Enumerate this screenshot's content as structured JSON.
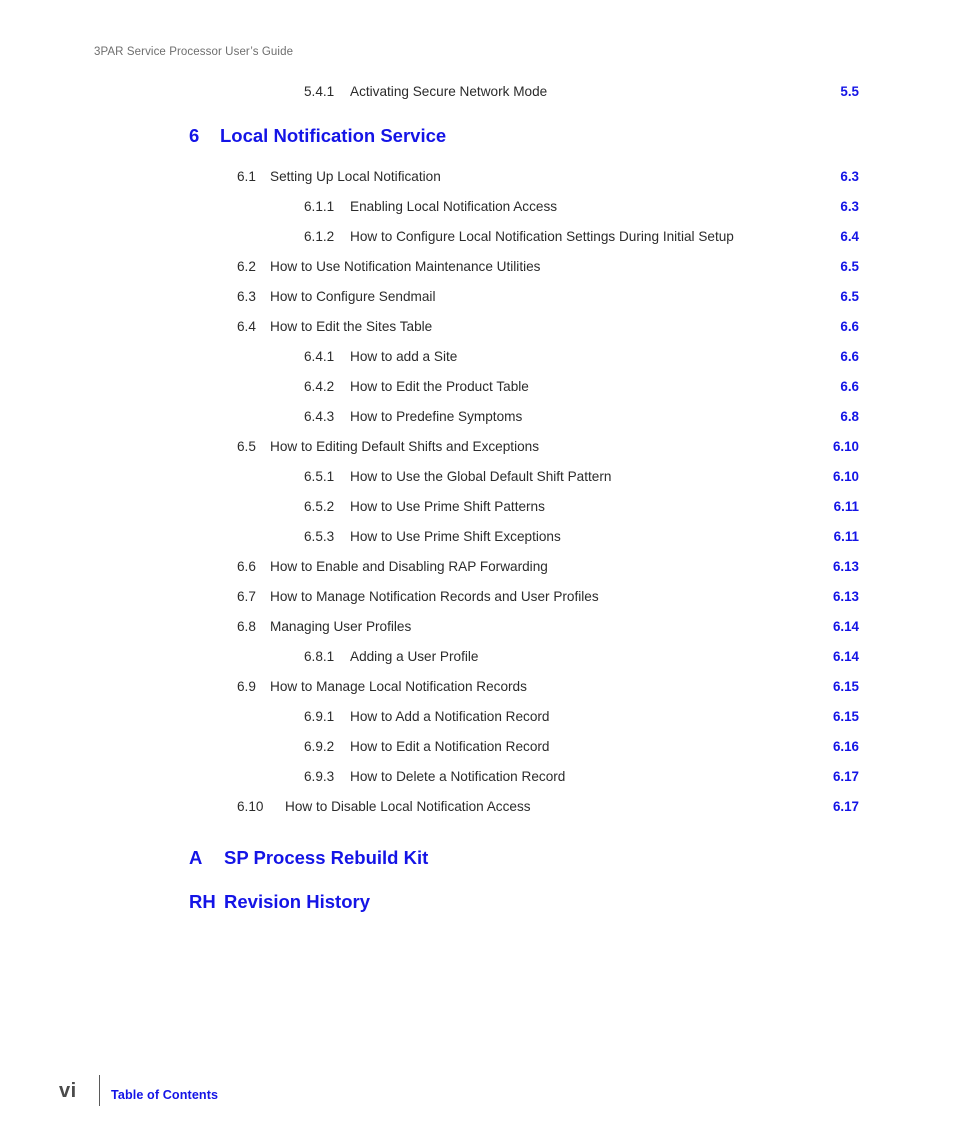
{
  "header": {
    "running_title": "3PAR Service Processor User’s Guide"
  },
  "toc": {
    "entries": [
      {
        "level": 3,
        "number": "5.4.1",
        "title": "Activating Secure Network Mode",
        "page": "5.5"
      },
      {
        "level": 2,
        "number": "6.1",
        "title": "Setting Up Local Notification",
        "page": "6.3"
      },
      {
        "level": 3,
        "number": "6.1.1",
        "title": "Enabling Local Notification Access",
        "page": "6.3"
      },
      {
        "level": 3,
        "number": "6.1.2",
        "title": "How to Configure Local Notification Settings During Initial Setup",
        "page": "6.4"
      },
      {
        "level": 2,
        "number": "6.2",
        "title": "How to Use Notification Maintenance Utilities",
        "page": "6.5"
      },
      {
        "level": 2,
        "number": "6.3",
        "title": "How to Configure Sendmail",
        "page": "6.5"
      },
      {
        "level": 2,
        "number": "6.4",
        "title": "How to Edit the Sites Table",
        "page": "6.6"
      },
      {
        "level": 3,
        "number": "6.4.1",
        "title": "How to add a Site",
        "page": "6.6"
      },
      {
        "level": 3,
        "number": "6.4.2",
        "title": "How to Edit the Product Table",
        "page": "6.6"
      },
      {
        "level": 3,
        "number": "6.4.3",
        "title": "How to Predefine Symptoms",
        "page": "6.8"
      },
      {
        "level": 2,
        "number": "6.5",
        "title": "How to Editing Default Shifts and Exceptions",
        "page": "6.10"
      },
      {
        "level": 3,
        "number": "6.5.1",
        "title": "How to Use the Global Default Shift Pattern",
        "page": "6.10"
      },
      {
        "level": 3,
        "number": "6.5.2",
        "title": "How to Use Prime Shift Patterns",
        "page": "6.11"
      },
      {
        "level": 3,
        "number": "6.5.3",
        "title": "How to Use Prime Shift Exceptions",
        "page": "6.11"
      },
      {
        "level": 2,
        "number": "6.6",
        "title": "How to Enable and Disabling RAP Forwarding",
        "page": "6.13"
      },
      {
        "level": 2,
        "number": "6.7",
        "title": "How to Manage Notification Records and User Profiles",
        "page": "6.13"
      },
      {
        "level": 2,
        "number": "6.8",
        "title": "Managing User Profiles",
        "page": "6.14"
      },
      {
        "level": 3,
        "number": "6.8.1",
        "title": "Adding a User Profile",
        "page": "6.14"
      },
      {
        "level": 2,
        "number": "6.9",
        "title": "How to Manage Local Notification Records",
        "page": "6.15"
      },
      {
        "level": 3,
        "number": "6.9.1",
        "title": "How to Add a Notification Record",
        "page": "6.15"
      },
      {
        "level": 3,
        "number": "6.9.2",
        "title": "How to Edit a Notification Record",
        "page": "6.16"
      },
      {
        "level": 3,
        "number": "6.9.3",
        "title": "How to Delete a Notification Record",
        "page": "6.17"
      },
      {
        "level": 2,
        "number": "6.10",
        "title": "How to Disable Local Notification Access",
        "page": "6.17"
      }
    ],
    "chapter_heading": {
      "number": "6",
      "title": "Local Notification Service"
    },
    "appendix_headings": [
      {
        "number": "A",
        "title": "SP Process Rebuild Kit"
      },
      {
        "number": "RH",
        "title": "Revision History"
      }
    ]
  },
  "footer": {
    "folio": "vi",
    "label": "Table of Contents"
  },
  "colors": {
    "accent_blue": "#1414e6",
    "body_text": "#2b2b2b",
    "header_gray": "#6e6e6e",
    "folio_gray": "#4a4a4a"
  }
}
